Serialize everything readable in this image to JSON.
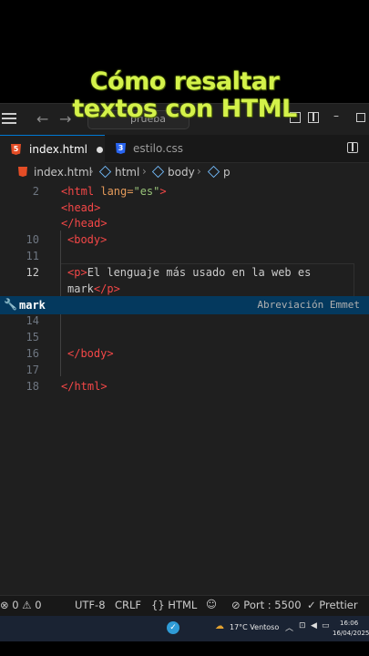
{
  "overlay": {
    "line1": "Cómo resaltar",
    "line2": "textos con HTML"
  },
  "titlebar": {
    "search_text": "prueba"
  },
  "tabs": [
    {
      "label": "index.html",
      "icon": "html5-icon"
    },
    {
      "label": "estilo.css",
      "icon": "css3-icon"
    }
  ],
  "breadcrumb": {
    "file": "index.html",
    "items": [
      "html",
      "body",
      "p"
    ]
  },
  "editor": {
    "lines": [
      {
        "n": "2",
        "tag_open": "<html ",
        "attr": "lang=",
        "str": "\"es\"",
        "tag_close": ">"
      },
      {
        "n": "",
        "text": "<head>"
      },
      {
        "n": "",
        "text": "</head>"
      },
      {
        "n": "10",
        "text": "<body>"
      },
      {
        "n": "11",
        "text": ""
      },
      {
        "n": "12",
        "p_open": "<p>",
        "content": "El lenguaje más usado en la web es",
        "content2": "mark",
        "p_close": "</p>"
      },
      {
        "n": "14",
        "text": ""
      },
      {
        "n": "15",
        "text": ""
      },
      {
        "n": "16",
        "text": "</body>"
      },
      {
        "n": "17",
        "text": ""
      },
      {
        "n": "18",
        "text": "</html>"
      }
    ],
    "suggestion": {
      "label": "mark",
      "detail": "Abreviación Emmet"
    }
  },
  "statusbar": {
    "errors": "0",
    "warnings": "0",
    "encoding": "UTF-8",
    "eol": "CRLF",
    "language": "HTML",
    "port": "Port : 5500",
    "prettier": "Prettier"
  },
  "taskbar": {
    "weather": "17°C  Ventoso",
    "time": "16:06",
    "date": "16/04/2025"
  },
  "colors": {
    "accent": "#0078d4",
    "title_text": "#d4f24a"
  }
}
